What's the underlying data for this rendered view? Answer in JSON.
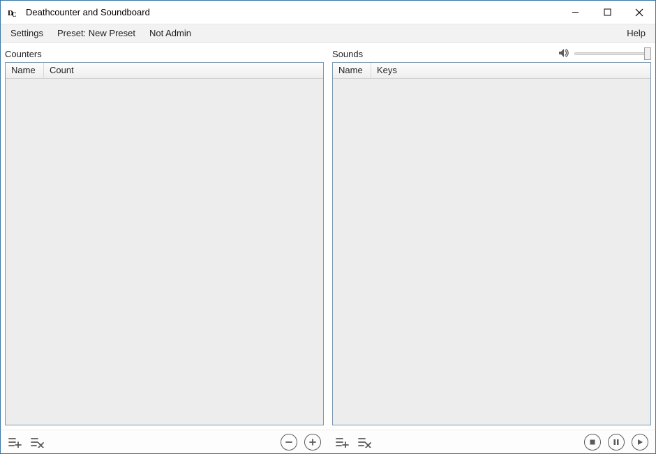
{
  "window": {
    "title": "Deathcounter and Soundboard"
  },
  "menu": {
    "settings": "Settings",
    "preset": "Preset: New Preset",
    "not_admin": "Not Admin",
    "help": "Help"
  },
  "panels": {
    "counters": {
      "label": "Counters",
      "columns": {
        "name": "Name",
        "count": "Count"
      },
      "rows": []
    },
    "sounds": {
      "label": "Sounds",
      "columns": {
        "name": "Name",
        "keys": "Keys"
      },
      "rows": [],
      "volume": {
        "value": 100,
        "max": 100
      }
    }
  },
  "icons": {
    "list_add": "list-add-icon",
    "list_remove": "list-remove-icon",
    "minus": "minus-icon",
    "plus": "plus-icon",
    "stop": "stop-icon",
    "pause": "pause-icon",
    "play": "play-icon",
    "volume": "volume-icon"
  }
}
